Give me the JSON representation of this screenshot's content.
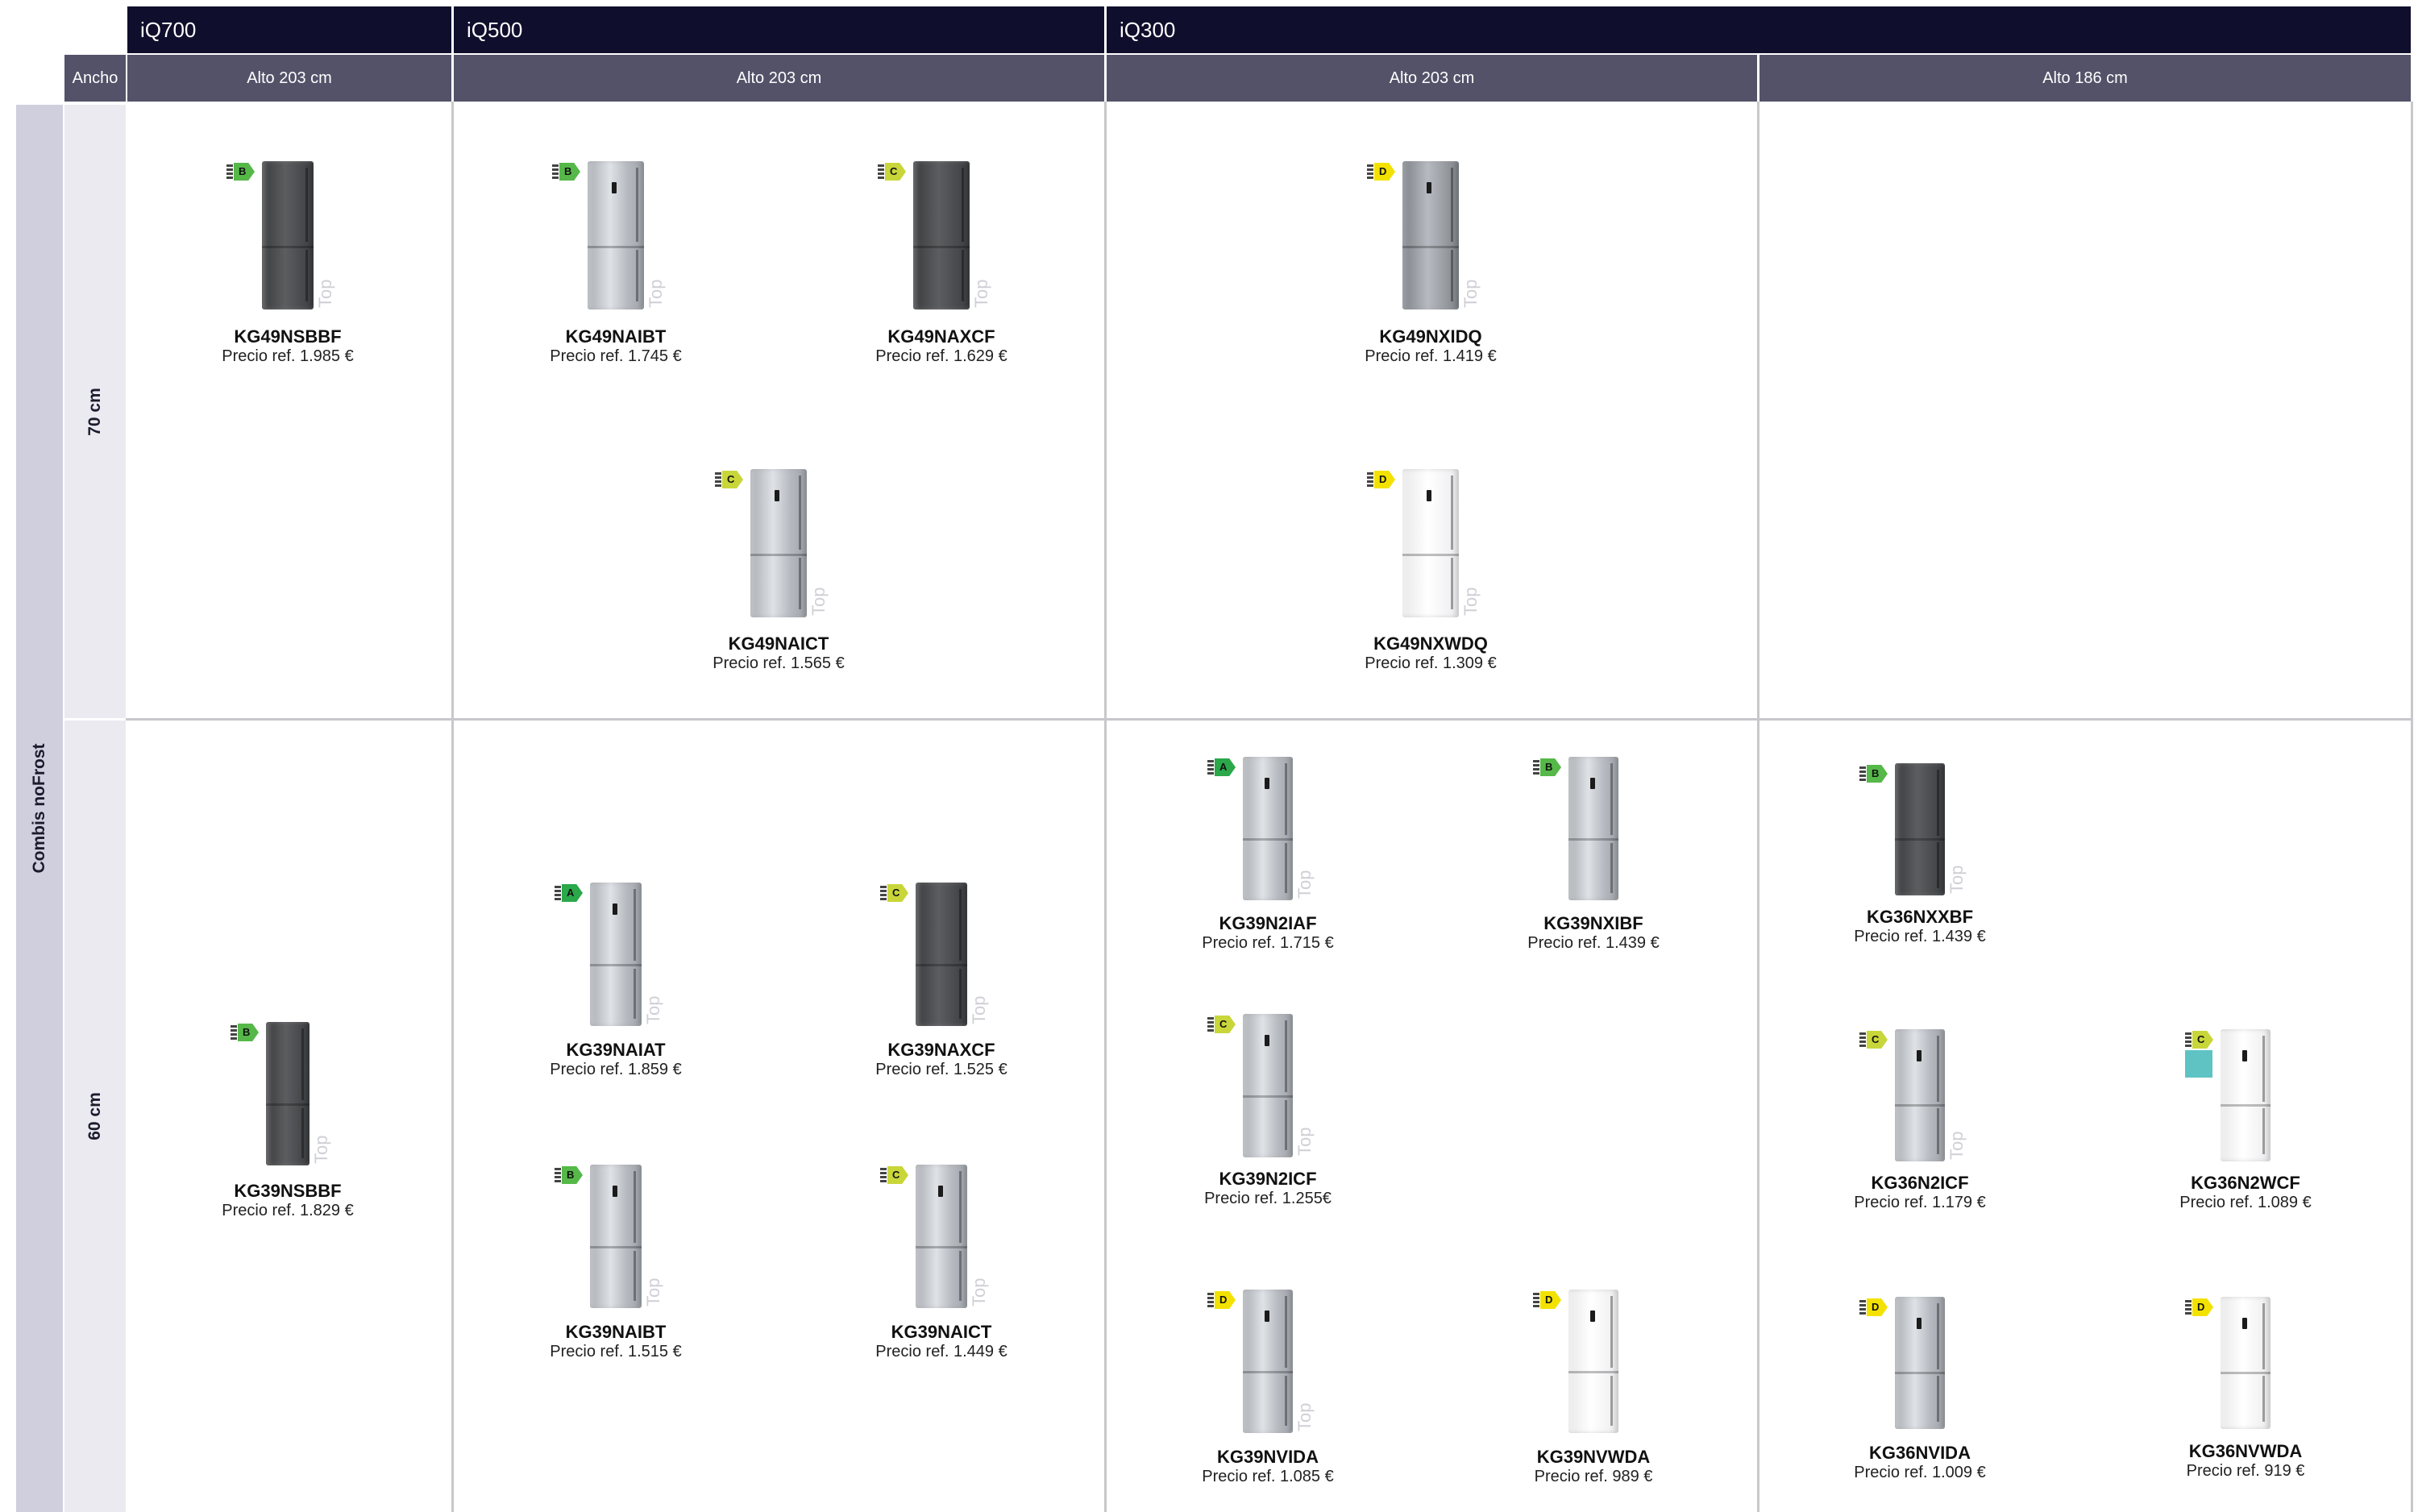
{
  "series_headers": [
    {
      "label": "iQ700"
    },
    {
      "label": "iQ500"
    },
    {
      "label": "iQ300"
    }
  ],
  "height_headers": [
    {
      "label": "Alto 203 cm"
    },
    {
      "label": "Alto 203 cm"
    },
    {
      "label": "Alto 203 cm"
    },
    {
      "label": "Alto 186 cm"
    }
  ],
  "width_header": "Ancho",
  "category": "Combis noFrost",
  "width_rows": [
    {
      "label": "70 cm"
    },
    {
      "label": "60 cm"
    }
  ],
  "top_text": "Top",
  "label_colors": {
    "A": "#2aa84a",
    "B": "#55b848",
    "C": "#c8d63a",
    "D": "#f3e200"
  },
  "products": [
    {
      "model": "KG49NSBBF",
      "price": "Precio ref. 1.985 €",
      "energy": "B",
      "finish": "dark",
      "top": true
    },
    {
      "model": "KG49NAIBT",
      "price": "Precio ref. 1.745 €",
      "energy": "B",
      "finish": "inox",
      "top": true
    },
    {
      "model": "KG49NAXCF",
      "price": "Precio ref. 1.629 €",
      "energy": "C",
      "finish": "dark",
      "top": true
    },
    {
      "model": "KG49NAICT",
      "price": "Precio ref. 1.565 €",
      "energy": "C",
      "finish": "inox",
      "top": true
    },
    {
      "model": "KG49NXIDQ",
      "price": "Precio ref. 1.419 €",
      "energy": "D",
      "finish": "inoxdark",
      "top": true
    },
    {
      "model": "KG49NXWDQ",
      "price": "Precio ref. 1.309 €",
      "energy": "D",
      "finish": "white",
      "top": true
    },
    {
      "model": "KG39NSBBF",
      "price": "Precio ref. 1.829 €",
      "energy": "B",
      "finish": "dark",
      "top": true
    },
    {
      "model": "KG39NAIAT",
      "price": "Precio ref. 1.859 €",
      "energy": "A",
      "finish": "inox",
      "top": true
    },
    {
      "model": "KG39NAXCF",
      "price": "Precio ref. 1.525 €",
      "energy": "C",
      "finish": "dark",
      "top": true
    },
    {
      "model": "KG39NAIBT",
      "price": "Precio ref. 1.515 €",
      "energy": "B",
      "finish": "inox",
      "top": true
    },
    {
      "model": "KG39NAICT",
      "price": "Precio ref. 1.449 €",
      "energy": "C",
      "finish": "inox",
      "top": true
    },
    {
      "model": "KG39N2IAF",
      "price": "Precio ref. 1.715 €",
      "energy": "A",
      "finish": "inox",
      "top": true
    },
    {
      "model": "KG39NXIBF",
      "price": "Precio ref. 1.439 €",
      "energy": "B",
      "finish": "inox",
      "top": false
    },
    {
      "model": "KG39N2ICF",
      "price": "Precio ref. 1.255€",
      "energy": "C",
      "finish": "inox",
      "top": true
    },
    {
      "model": "KG39NVIDA",
      "price": "Precio ref. 1.085 €",
      "energy": "D",
      "finish": "inox",
      "top": true
    },
    {
      "model": "KG39NVWDA",
      "price": "Precio ref. 989 €",
      "energy": "D",
      "finish": "white",
      "top": false
    },
    {
      "model": "KG36NXXBF",
      "price": "Precio ref. 1.439 €",
      "energy": "B",
      "finish": "dark",
      "top": true
    },
    {
      "model": "KG36N2ICF",
      "price": "Precio ref. 1.179 €",
      "energy": "C",
      "finish": "inox",
      "top": true
    },
    {
      "model": "KG36N2WCF",
      "price": "Precio ref. 1.089 €",
      "energy": "C",
      "finish": "white",
      "top": false,
      "new_badge": true
    },
    {
      "model": "KG36NVIDA",
      "price": "Precio ref. 1.009 €",
      "energy": "D",
      "finish": "inox",
      "top": false
    },
    {
      "model": "KG36NVWDA",
      "price": "Precio ref. 919 €",
      "energy": "D",
      "finish": "white",
      "top": false
    }
  ]
}
